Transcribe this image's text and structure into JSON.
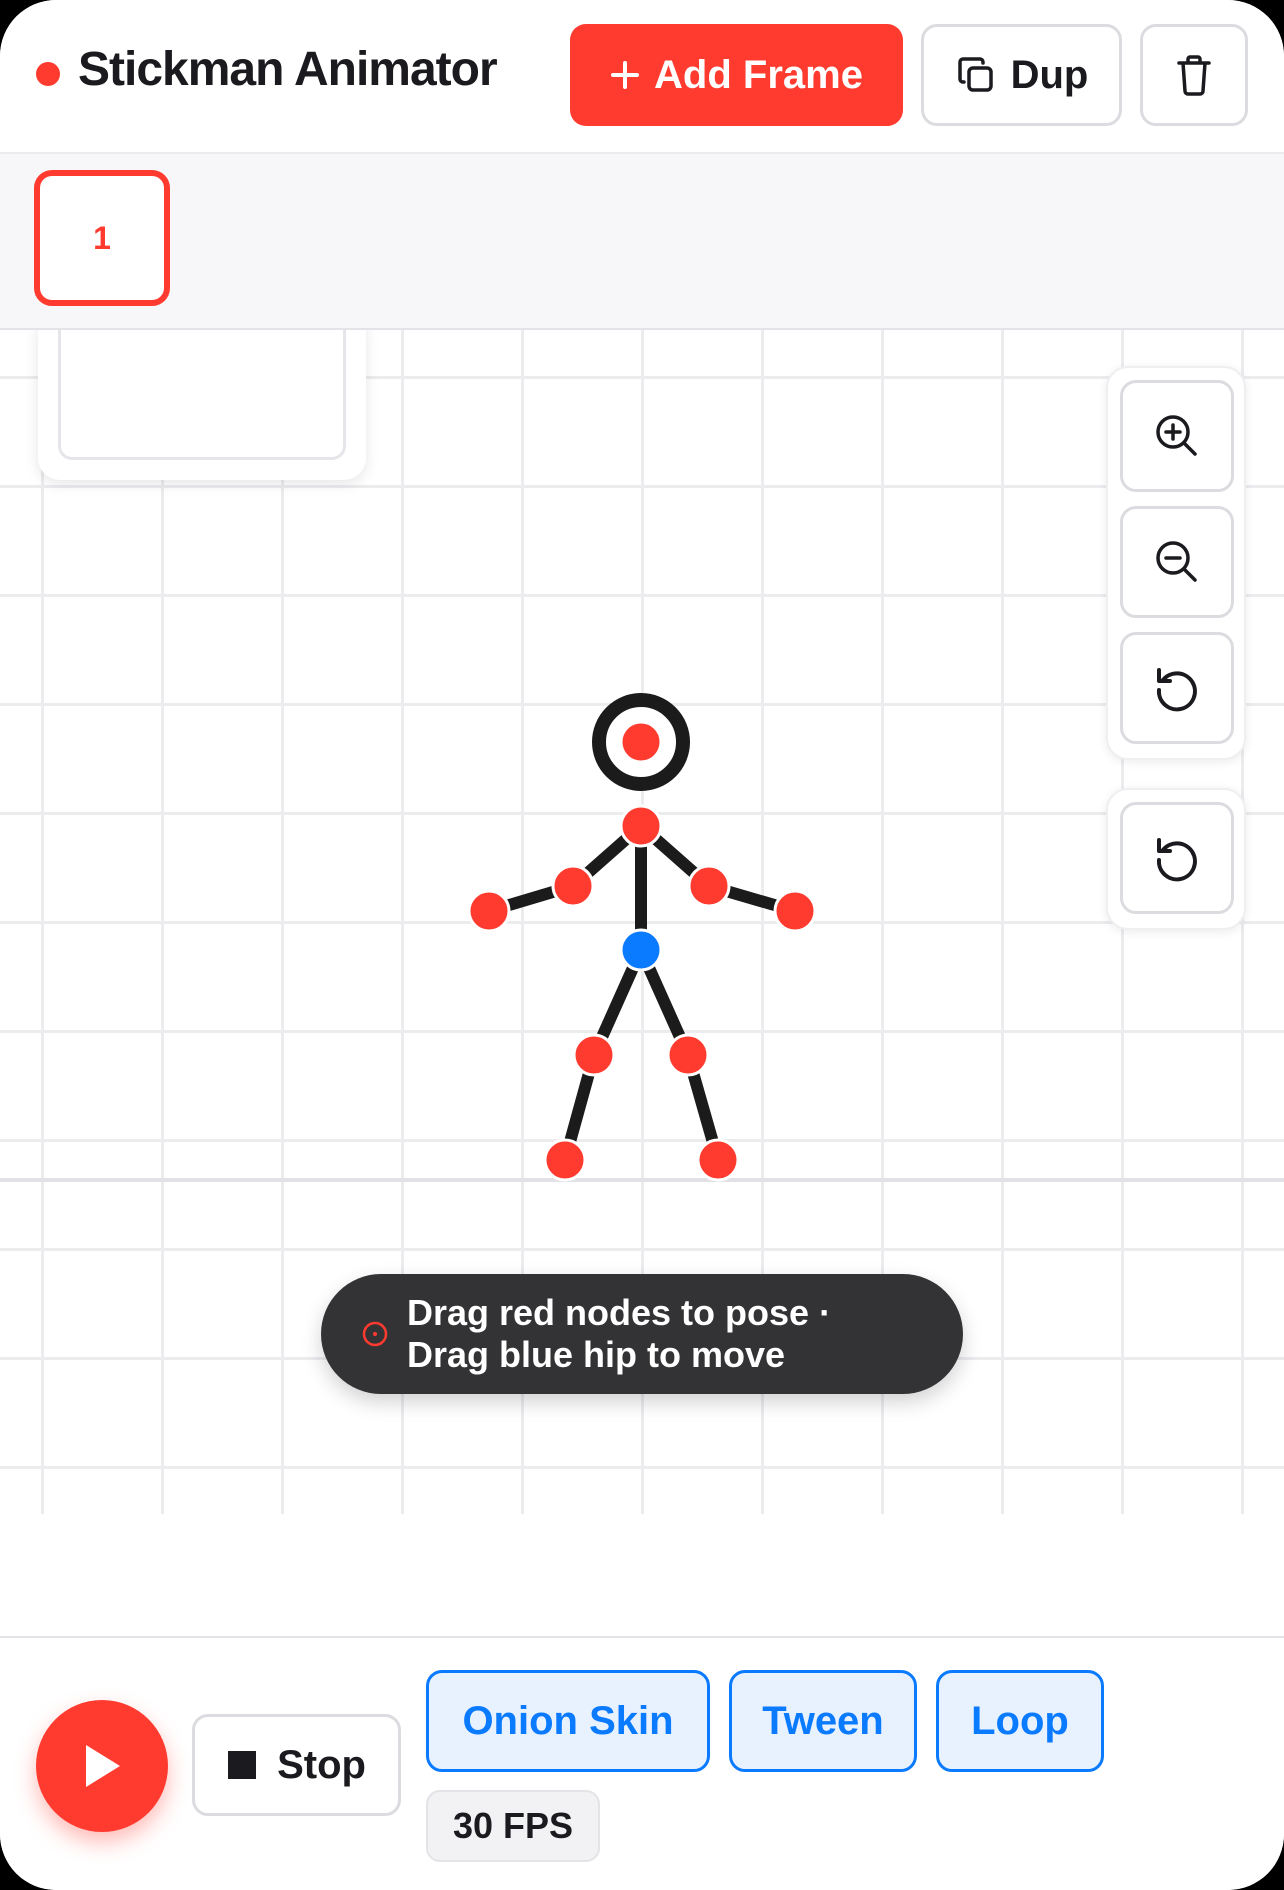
{
  "header": {
    "title": "Stickman Animator",
    "add_frame_label": "Add Frame",
    "dup_label": "Dup"
  },
  "frames": {
    "items": [
      {
        "label": "1",
        "selected": true
      }
    ]
  },
  "canvas": {
    "hint": {
      "line1": "Drag red nodes to pose ·",
      "line2": "Drag blue hip to move"
    },
    "tools": [
      "zoom-in-icon",
      "zoom-out-icon",
      "reset-view-icon",
      "reset-pose-icon"
    ]
  },
  "playback": {
    "stop_label": "Stop",
    "toggles": {
      "onion_skin": "Onion Skin",
      "tween": "Tween",
      "loop": "Loop"
    },
    "fps_label": "30 FPS"
  },
  "colors": {
    "accent": "#ff3b30",
    "toggle_blue": "#0a7aff",
    "hip_node": "#0a7aff",
    "limb": "#1b1b1b"
  }
}
